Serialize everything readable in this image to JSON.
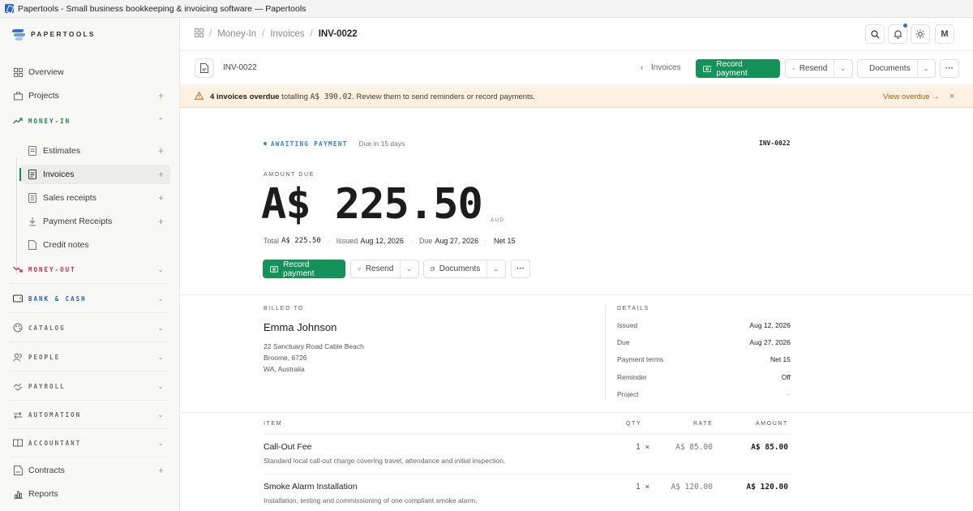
{
  "window": {
    "title": "Papertools - Small business bookkeeping & invoicing software — Papertools"
  },
  "brand": {
    "name": "PAPERTOOLS"
  },
  "sidebar": {
    "overview": "Overview",
    "projects": "Projects",
    "money_in": "MONEY-IN",
    "money_in_items": [
      "Estimates",
      "Invoices",
      "Sales receipts",
      "Payment Receipts",
      "Credit notes"
    ],
    "money_out": "MONEY-OUT",
    "bank_cash": "BANK & CASH",
    "catalog": "CATALOG",
    "people": "PEOPLE",
    "payroll": "PAYROLL",
    "automation": "AUTOMATION",
    "accountant": "ACCOUNTANT",
    "contracts": "Contracts",
    "reports": "Reports"
  },
  "breadcrumb": {
    "section": "Money-In",
    "page": "Invoices",
    "current": "INV-0022"
  },
  "topbar": {
    "avatar": "M"
  },
  "toolbar": {
    "doc_title": "INV-0022",
    "back_link": "Invoices",
    "record_payment": "Record payment",
    "resend": "Resend",
    "documents": "Documents",
    "more": "···"
  },
  "banner": {
    "count_text": "4 invoices overdue",
    "mid_text": " totalling ",
    "amount": "A$ 390.02",
    "tail_text": ". Review them to send reminders or record payments.",
    "link": "View overdue →",
    "close": "×"
  },
  "invoice": {
    "status": "AWAITING PAYMENT",
    "due_in": "Due in 15 days",
    "number": "INV-0022",
    "amount_label": "AMOUNT DUE",
    "amount": "A$ 225.50",
    "currency": "AUD",
    "total_label": "Total",
    "total": "A$ 225.50",
    "issued_label": "Issued",
    "issued": "Aug 12, 2026",
    "due_label": "Due",
    "due": "Aug 27, 2026",
    "terms": "Net 15",
    "actions": {
      "record_payment": "Record payment",
      "resend": "Resend",
      "documents": "Documents",
      "more": "···"
    }
  },
  "billed_to": {
    "label": "BILLED TO",
    "name": "Emma Johnson",
    "address": [
      "22 Sanctuary Road Cable Beach",
      "Broome, 6726",
      "WA, Australia"
    ]
  },
  "details": {
    "label": "DETAILS",
    "rows": [
      {
        "k": "Issued",
        "v": "Aug 12, 2026"
      },
      {
        "k": "Due",
        "v": "Aug 27, 2026"
      },
      {
        "k": "Payment terms",
        "v": "Net 15"
      },
      {
        "k": "Reminder",
        "v": "Off"
      },
      {
        "k": "Project",
        "v": "–"
      }
    ]
  },
  "items": {
    "headers": {
      "item": "ITEM",
      "qty": "QTY",
      "rate": "RATE",
      "amount": "AMOUNT"
    },
    "rows": [
      {
        "name": "Call-Out Fee",
        "desc": "Standard local call-out charge covering travel, attendance and initial inspection.",
        "qty": "1 ×",
        "rate": "A$ 85.00",
        "amount": "A$ 85.00"
      },
      {
        "name": "Smoke Alarm Installation",
        "desc": "Installation, testing and commissioning of one compliant smoke alarm.",
        "qty": "1 ×",
        "rate": "A$ 120.00",
        "amount": "A$ 120.00"
      }
    ]
  },
  "colors": {
    "accent": "#15915a",
    "money_in": "#17884e",
    "money_out": "#d6293e",
    "bank": "#2761c7",
    "banner_bg": "#fdf1e2",
    "status_blue": "#2d80c6"
  }
}
